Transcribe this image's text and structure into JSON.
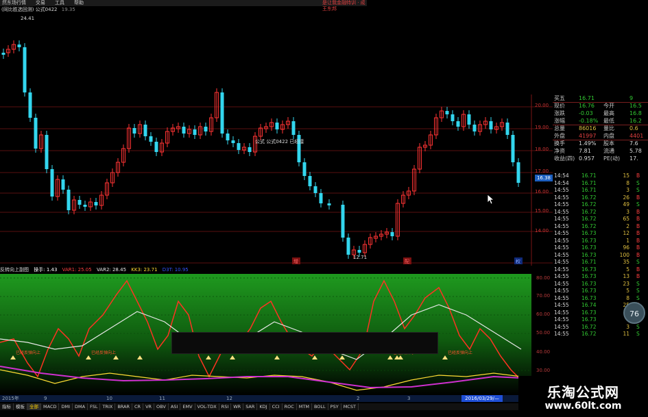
{
  "menubar": {
    "items": [
      "然东场行情",
      "交易",
      "工具",
      "帮助"
    ],
    "right": "是让我金融特训 · 成王东邦"
  },
  "titlebar": {
    "code": "(同比胜选回测) 公式0422",
    "value": "19.35"
  },
  "main_chart": {
    "high_label": "24.41",
    "low_label": "12.71",
    "formula_label": "公式 公式0422 已经接",
    "price_ticks": [
      "20.00",
      "19.00",
      "18.00",
      "17.00",
      "16.00",
      "15.00",
      "14.00"
    ],
    "current_price_tag": "16.38",
    "event_markers": [
      "增",
      "配",
      "权"
    ]
  },
  "quote_panel": {
    "rows": [
      {
        "k1": "买五",
        "v1": "16.71",
        "k2": "",
        "v2": "9",
        "c": "#33cc33"
      },
      {
        "k1": "现价",
        "v1": "16.76",
        "k2": "今开",
        "v2": "16.5",
        "c": "#33cc33"
      },
      {
        "k1": "涨跌",
        "v1": "-0.03",
        "k2": "最高",
        "v2": "16.8",
        "c": "#33cc33"
      },
      {
        "k1": "涨幅",
        "v1": "-0.18%",
        "k2": "最低",
        "v2": "16.2",
        "c": "#33cc33"
      },
      {
        "k1": "总量",
        "v1": "86016",
        "k2": "量比",
        "v2": "0.6",
        "c": "#e0c040"
      },
      {
        "k1": "外盘",
        "v1": "41997",
        "k2": "内盘",
        "v2": "4401",
        "c": "#e04040"
      },
      {
        "k1": "换手",
        "v1": "1.49%",
        "k2": "股本",
        "v2": "7.6",
        "c": "#ddd"
      },
      {
        "k1": "净资",
        "v1": "7.81",
        "k2": "流通",
        "v2": "5.78",
        "c": "#ddd"
      },
      {
        "k1": "收益(四)",
        "v1": "0.957",
        "k2": "PE(动)",
        "v2": "17.",
        "c": "#ddd"
      }
    ]
  },
  "ticks": [
    {
      "t": "14:54",
      "p": "16.71",
      "v": "15",
      "s": "B"
    },
    {
      "t": "14:54",
      "p": "16.71",
      "v": "8",
      "s": "S"
    },
    {
      "t": "14:55",
      "p": "16.71",
      "v": "3",
      "s": "S"
    },
    {
      "t": "14:55",
      "p": "16.72",
      "v": "26",
      "s": "B"
    },
    {
      "t": "14:55",
      "p": "16.72",
      "v": "49",
      "s": "S"
    },
    {
      "t": "14:55",
      "p": "16.72",
      "v": "3",
      "s": "B"
    },
    {
      "t": "14:55",
      "p": "16.72",
      "v": "65",
      "s": "B"
    },
    {
      "t": "14:55",
      "p": "16.72",
      "v": "2",
      "s": "B"
    },
    {
      "t": "14:55",
      "p": "16.73",
      "v": "12",
      "s": "B"
    },
    {
      "t": "14:55",
      "p": "16.73",
      "v": "1",
      "s": "B"
    },
    {
      "t": "14:55",
      "p": "16.73",
      "v": "96",
      "s": "B"
    },
    {
      "t": "14:55",
      "p": "16.73",
      "v": "100",
      "s": "B"
    },
    {
      "t": "14:55",
      "p": "16.71",
      "v": "35",
      "s": "S"
    },
    {
      "t": "14:55",
      "p": "16.73",
      "v": "5",
      "s": "B"
    },
    {
      "t": "14:55",
      "p": "16.73",
      "v": "13",
      "s": "B"
    },
    {
      "t": "14:55",
      "p": "16.73",
      "v": "23",
      "s": "S"
    },
    {
      "t": "14:55",
      "p": "16.73",
      "v": "5",
      "s": "S"
    },
    {
      "t": "14:55",
      "p": "16.73",
      "v": "8",
      "s": "S"
    },
    {
      "t": "14:55",
      "p": "16.74",
      "v": "25",
      "s": "B"
    },
    {
      "t": "14:55",
      "p": "16.73",
      "v": "5",
      "s": "B"
    },
    {
      "t": "14:55",
      "p": "16.73",
      "v": "4",
      "s": "S"
    },
    {
      "t": "14:55",
      "p": "16.72",
      "v": "3",
      "s": "S"
    },
    {
      "t": "14:55",
      "p": "16.72",
      "v": "11",
      "s": "S"
    }
  ],
  "indicator": {
    "name": "反转向上副图",
    "params": [
      {
        "label": "操手: 1.43",
        "color": "#ffffff"
      },
      {
        "label": "VAR1: 25.05",
        "color": "#ff4040"
      },
      {
        "label": "VAR2: 28.45",
        "color": "#e8e8e8"
      },
      {
        "label": "KK3: 23.71",
        "color": "#ffdd33"
      },
      {
        "label": "D3T: 10.95",
        "color": "#3355ff"
      }
    ],
    "axis_ticks": [
      "80.00",
      "70.00",
      "60.00",
      "50.00",
      "40.00",
      "30.00"
    ],
    "signal_text": "已经反弹向上",
    "badge": "76"
  },
  "datebar": {
    "year": "2015年",
    "marks": [
      "9",
      "10",
      "11",
      "12",
      "2",
      "3"
    ],
    "current_date": "2016/03/29/—"
  },
  "tabs": [
    "指标",
    "模板",
    "全部",
    "MACD",
    "DMI",
    "DMA",
    "FSL",
    "TRIX",
    "BRAR",
    "CR",
    "VR",
    "OBV",
    "ASI",
    "EMV",
    "VOL-TDX",
    "RSI",
    "WR",
    "SAR",
    "KDJ",
    "CCI",
    "ROC",
    "MTM",
    "BOLL",
    "PSY",
    "MCST"
  ],
  "active_tab": "全部",
  "watermark": {
    "cn": "乐淘公式网",
    "url": "www.60lt.com"
  },
  "colors": {
    "up": "#ff3333",
    "down": "#33d6ee",
    "grid": "#6a1414",
    "panel_green": "#1a8c1a"
  }
}
